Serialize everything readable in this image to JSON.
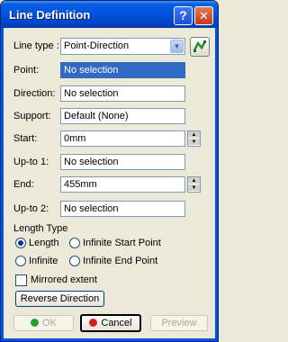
{
  "window": {
    "title": "Line Definition",
    "help_button": "?",
    "close_button": "✕"
  },
  "form": {
    "line_type": {
      "label": "Line type :",
      "value": "Point-Direction"
    },
    "point": {
      "label": "Point:",
      "value": "No selection"
    },
    "direction": {
      "label": "Direction:",
      "value": "No selection"
    },
    "support": {
      "label": "Support:",
      "value": "Default (None)"
    },
    "start": {
      "label": "Start:",
      "value": "0mm"
    },
    "upto1": {
      "label": "Up-to 1:",
      "value": "No selection"
    },
    "end": {
      "label": "End:",
      "value": "455mm"
    },
    "upto2": {
      "label": "Up-to 2:",
      "value": "No selection"
    }
  },
  "length_type": {
    "title": "Length Type",
    "options": [
      "Length",
      "Infinite Start Point",
      "Infinite",
      "Infinite End Point"
    ],
    "selected": "Length"
  },
  "mirrored_extent": {
    "label": "Mirrored extent",
    "checked": false
  },
  "reverse_direction": "Reverse Direction",
  "buttons": {
    "ok": "OK",
    "cancel": "Cancel",
    "preview": "Preview"
  },
  "colors": {
    "title_bar": "#0054E3",
    "dialog_bg": "#ECE9D8",
    "selection": "#316AC5",
    "ok_icon": "#2AA02A",
    "cancel_icon": "#D42020"
  }
}
